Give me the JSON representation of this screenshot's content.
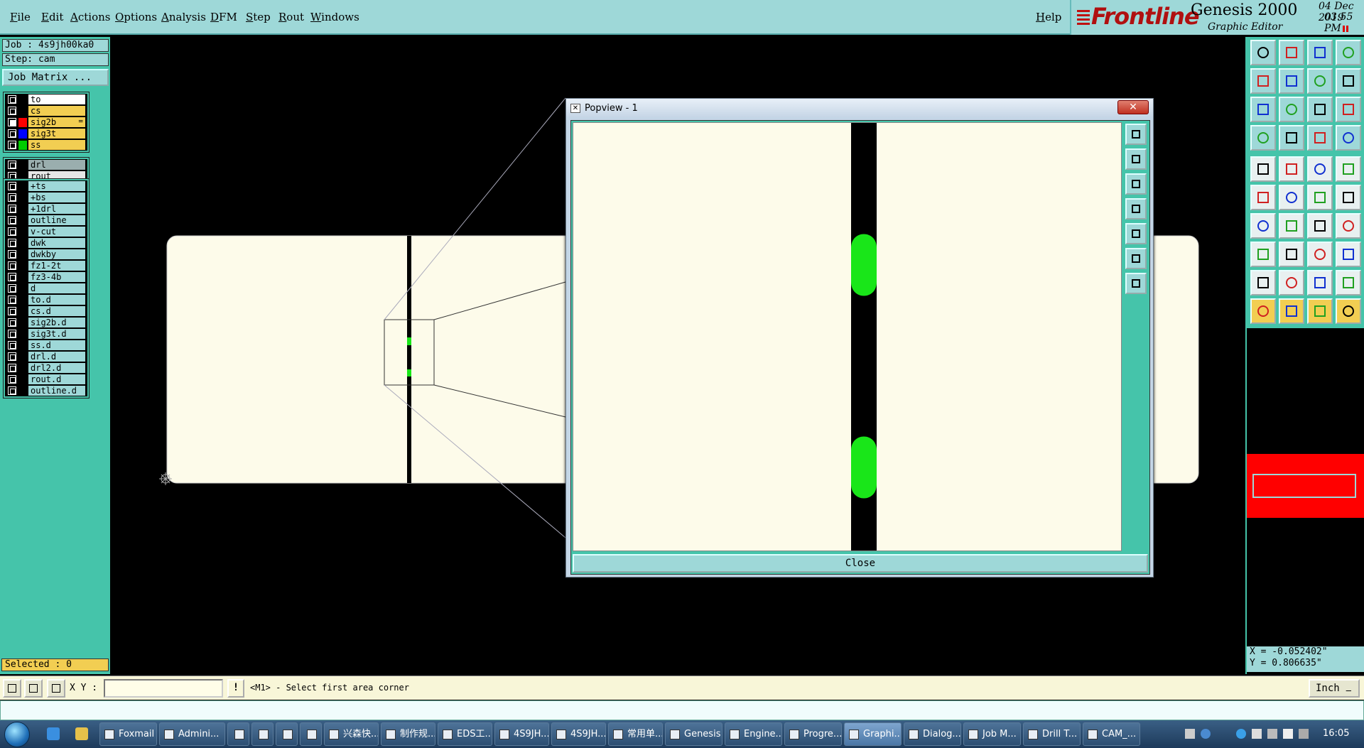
{
  "menubar": {
    "items": [
      "File",
      "Edit",
      "Actions",
      "Options",
      "Analysis",
      "DFM",
      "Step",
      "Rout",
      "Windows"
    ],
    "help": "Help"
  },
  "brand": {
    "logo": "Frontline",
    "product": "Genesis 2000",
    "subtitle": "Graphic Editor",
    "date": "04 Dec 2019",
    "time": "03:55 PM"
  },
  "left_panel": {
    "job": "Job : 4s9jh00ka0",
    "step": "Step: cam",
    "job_matrix": "Job Matrix ...",
    "signal_layers": [
      {
        "name": "to",
        "bg": "#ffffff",
        "swatch": "#000000",
        "checked": false
      },
      {
        "name": "cs",
        "bg": "#f2ce52",
        "swatch": "#000000",
        "checked": false
      },
      {
        "name": "sig2b",
        "bg": "#f2ce52",
        "swatch": "#ff0000",
        "checked": true,
        "mark": "="
      },
      {
        "name": "sig3t",
        "bg": "#f2ce52",
        "swatch": "#0000ff",
        "checked": false
      },
      {
        "name": "ss",
        "bg": "#f2ce52",
        "swatch": "#00cc00",
        "checked": false
      }
    ],
    "drill_layers": [
      {
        "name": "drl",
        "bg": "#9aaeae",
        "swatch": "#000000",
        "checked": false
      },
      {
        "name": "rout",
        "bg": "#e6e6e6",
        "swatch": "#000000",
        "checked": false
      }
    ],
    "other_layers": [
      {
        "name": "+ts"
      },
      {
        "name": "+bs"
      },
      {
        "name": "+1drl"
      },
      {
        "name": "outline"
      },
      {
        "name": "v-cut"
      },
      {
        "name": "dwk"
      },
      {
        "name": "dwkby"
      },
      {
        "name": "fz1-2t"
      },
      {
        "name": "fz3-4b"
      },
      {
        "name": "d"
      },
      {
        "name": "to.d"
      },
      {
        "name": "cs.d"
      },
      {
        "name": "sig2b.d"
      },
      {
        "name": "sig3t.d"
      },
      {
        "name": "ss.d"
      },
      {
        "name": "drl.d"
      },
      {
        "name": "drl2.d"
      },
      {
        "name": "rout.d"
      },
      {
        "name": "outline.d"
      }
    ],
    "selected": "Selected : 0"
  },
  "popview": {
    "title": "Popview - 1",
    "close_x": "✕",
    "close_button": "Close"
  },
  "coords": {
    "x": "X = -0.052402\"",
    "y": "Y = 0.806635\""
  },
  "cmdline": {
    "xy_label": "X Y :",
    "xy_value": "",
    "excl": "!",
    "prompt": "<M1> - Select first area corner",
    "unit": "Inch"
  },
  "taskbar": {
    "items": [
      {
        "label": "Foxmail"
      },
      {
        "label": "Admini..."
      },
      {
        "label": ""
      },
      {
        "label": ""
      },
      {
        "label": ""
      },
      {
        "label": ""
      },
      {
        "label": "兴森快..."
      },
      {
        "label": "制作规..."
      },
      {
        "label": "EDS工..."
      },
      {
        "label": "4S9JH..."
      },
      {
        "label": "4S9JH..."
      },
      {
        "label": "常用单..."
      },
      {
        "label": "Genesis"
      },
      {
        "label": "Engine..."
      },
      {
        "label": "Progre..."
      },
      {
        "label": "Graphi..."
      },
      {
        "label": "Dialog..."
      },
      {
        "label": "Job M..."
      },
      {
        "label": "Drill T..."
      },
      {
        "label": "CAM_..."
      }
    ],
    "clock": "16:05"
  }
}
